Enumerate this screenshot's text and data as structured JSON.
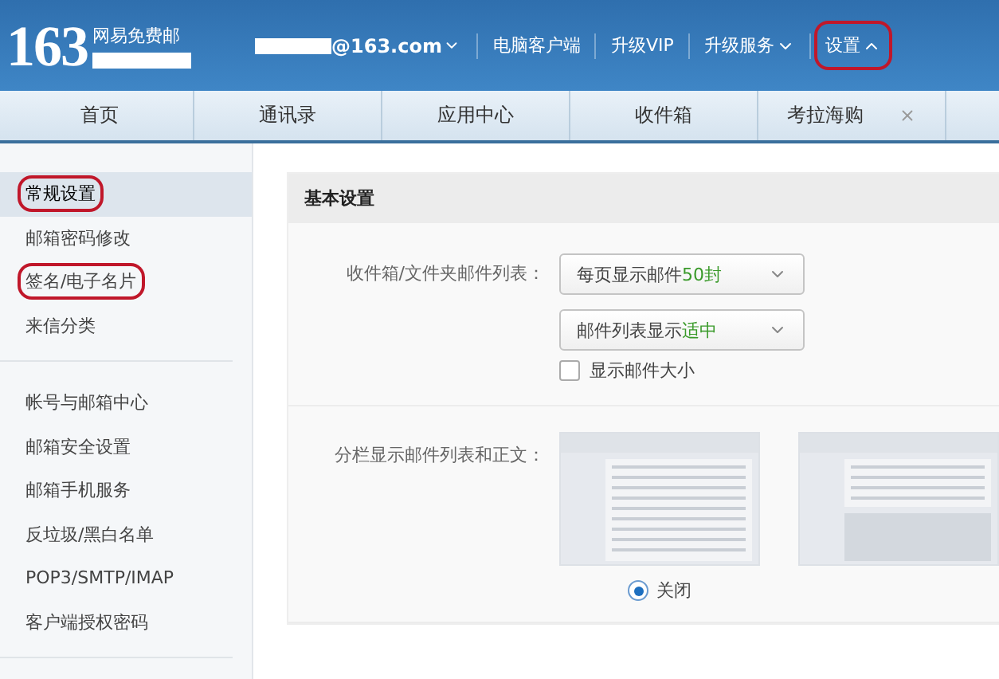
{
  "header": {
    "logo": "163",
    "product": "网易免费邮",
    "account": "@163.com",
    "links": [
      {
        "label": "电脑客户端",
        "kind": "link",
        "annotated": false
      },
      {
        "label": "升级VIP",
        "kind": "link",
        "annotated": false
      },
      {
        "label": "升级服务",
        "kind": "menu",
        "expanded": false,
        "annotated": false
      },
      {
        "label": "设置",
        "kind": "menu",
        "expanded": true,
        "annotated": true
      }
    ]
  },
  "tabs": [
    {
      "label": "首页",
      "selected": false,
      "closable": false
    },
    {
      "label": "通讯录",
      "selected": false,
      "closable": false
    },
    {
      "label": "应用中心",
      "selected": false,
      "closable": false
    },
    {
      "label": "收件箱",
      "selected": false,
      "closable": false
    },
    {
      "label": "考拉海购",
      "selected": false,
      "closable": true
    }
  ],
  "sidebar": {
    "groups": [
      {
        "items": [
          {
            "label": "常规设置",
            "selected": true,
            "annotated": true
          },
          {
            "label": "邮箱密码修改",
            "selected": false,
            "annotated": false
          },
          {
            "label": "签名/电子名片",
            "selected": false,
            "annotated": true
          },
          {
            "label": "来信分类",
            "selected": false,
            "annotated": false
          }
        ]
      },
      {
        "items": [
          {
            "label": "帐号与邮箱中心",
            "selected": false,
            "annotated": false
          },
          {
            "label": "邮箱安全设置",
            "selected": false,
            "annotated": false
          },
          {
            "label": "邮箱手机服务",
            "selected": false,
            "annotated": false
          },
          {
            "label": "反垃圾/黑白名单",
            "selected": false,
            "annotated": false
          },
          {
            "label": "POP3/SMTP/IMAP",
            "selected": false,
            "annotated": false
          },
          {
            "label": "客户端授权密码",
            "selected": false,
            "annotated": false
          }
        ]
      }
    ]
  },
  "main": {
    "title": "基本设置",
    "list_setting": {
      "label": "收件箱/文件夹邮件列表：",
      "selects": [
        {
          "prefix": "每页显示邮件",
          "highlight": "50封"
        },
        {
          "prefix": "邮件列表显示",
          "highlight": "适中"
        }
      ],
      "checkbox": {
        "label": "显示邮件大小",
        "checked": false
      }
    },
    "split_setting": {
      "label": "分栏显示邮件列表和正文：",
      "options": [
        {
          "kind": "list",
          "label": "关闭",
          "selected": true
        },
        {
          "kind": "split"
        }
      ]
    }
  }
}
